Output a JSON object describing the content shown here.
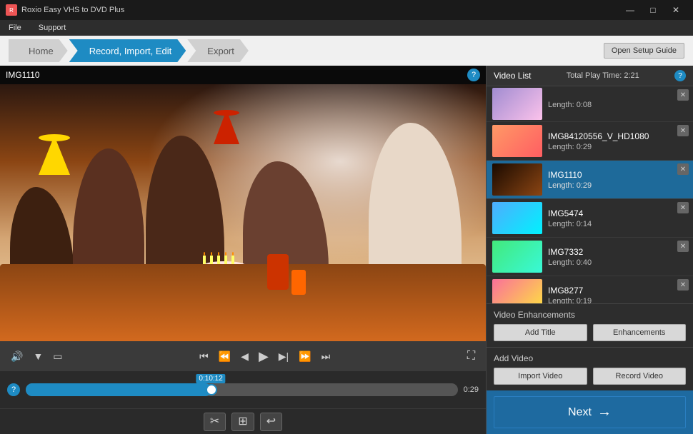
{
  "titleBar": {
    "appName": "Roxio Easy VHS to DVD Plus",
    "icon": "R",
    "minimize": "—",
    "maximize": "□",
    "close": "✕"
  },
  "menuBar": {
    "items": [
      "File",
      "Support"
    ]
  },
  "nav": {
    "steps": [
      {
        "id": "home",
        "label": "Home",
        "active": false
      },
      {
        "id": "record-import-edit",
        "label": "Record, Import, Edit",
        "active": true
      },
      {
        "id": "export",
        "label": "Export",
        "active": false
      }
    ],
    "setupGuideLabel": "Open Setup Guide"
  },
  "videoPanel": {
    "currentVideoLabel": "IMG1110",
    "helpTooltip": "?",
    "timeline": {
      "currentTime": "0:10:12",
      "duration": "0:29",
      "progressPercent": 43
    },
    "controls": {
      "volume": "🔊",
      "dropdown": "▼",
      "crop": "▭",
      "skipToStart": "⏮",
      "rewind": "⏪",
      "stepBack": "◀",
      "play": "▶",
      "stepForward": "▶",
      "fastForward": "⏩",
      "skipToEnd": "⏭",
      "fullscreen": "⛶"
    },
    "bottomTools": {
      "scissors": "✂",
      "image": "⊞",
      "undo": "↩"
    }
  },
  "videoList": {
    "title": "Video List",
    "totalPlayTime": "Total Play Time: 2:21",
    "helpTooltip": "?",
    "items": [
      {
        "id": "partial",
        "name": "",
        "length": "Length: 0:08",
        "thumbClass": "thumb-partial",
        "active": false,
        "partial": true
      },
      {
        "id": "img84120556",
        "name": "IMG84120556_V_HD1080",
        "length": "Length: 0:29",
        "thumbClass": "thumb-1",
        "active": false
      },
      {
        "id": "img1110",
        "name": "IMG1110",
        "length": "Length: 0:29",
        "thumbClass": "thumb-2",
        "active": true
      },
      {
        "id": "img5474",
        "name": "IMG5474",
        "length": "Length: 0:14",
        "thumbClass": "thumb-3",
        "active": false
      },
      {
        "id": "img7332",
        "name": "IMG7332",
        "length": "Length: 0:40",
        "thumbClass": "thumb-4",
        "active": false
      },
      {
        "id": "img8277",
        "name": "IMG8277",
        "length": "Length: 0:19",
        "thumbClass": "thumb-5",
        "active": false
      }
    ]
  },
  "enhancements": {
    "title": "Video Enhancements",
    "addTitleLabel": "Add Title",
    "enhancementsLabel": "Enhancements"
  },
  "addVideo": {
    "title": "Add Video",
    "importLabel": "Import Video",
    "recordLabel": "Record Video"
  },
  "nextButton": {
    "label": "Next",
    "arrow": "→"
  }
}
